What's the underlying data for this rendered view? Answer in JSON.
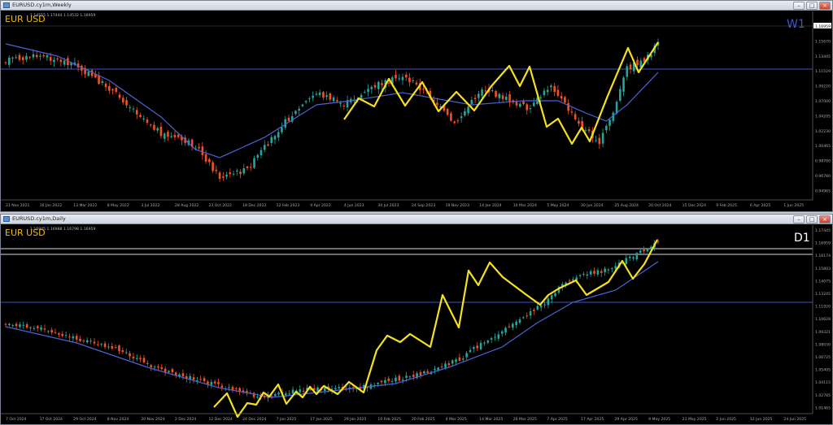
{
  "top_window": {
    "title": "EURUSD.cy1m,Weekly",
    "ohlc": "1.14555 1.17444 1.14532 1.16959",
    "symbol_label": "EUR USD",
    "timeframe_label": "W1",
    "price_labels": [
      "1.16959",
      "1.15670",
      "1.13445",
      "1.11529",
      "1.09220",
      "1.07000",
      "1.04205",
      "1.02230",
      "1.00465",
      "0.98780",
      "0.96780",
      "0.94965"
    ],
    "current_price": "1.16959",
    "hline_price": "1.11529",
    "date_labels": [
      "21 Nov 2021",
      "16 Jan 2022",
      "13 Mar 2022",
      "8 May 2022",
      "3 Jul 2022",
      "28 Aug 2022",
      "23 Oct 2022",
      "18 Dec 2022",
      "12 Feb 2023",
      "9 Apr 2023",
      "4 Jun 2023",
      "30 Jul 2023",
      "24 Sep 2023",
      "19 Nov 2023",
      "14 Jan 2024",
      "10 Mar 2024",
      "5 May 2024",
      "30 Jun 2024",
      "25 Aug 2024",
      "20 Oct 2024",
      "15 Dec 2024",
      "9 Feb 2025",
      "6 Apr 2025",
      "1 Jun 2025"
    ]
  },
  "bottom_window": {
    "title": "EURUSD.cy1m,Daily",
    "ohlc": "1.16945 1.16988 1.16798 1.16959",
    "symbol_label": "EUR USD",
    "timeframe_label": "D1",
    "price_labels": [
      "1.17445",
      "1.16959",
      "1.16174",
      "1.15803",
      "1.14075",
      "1.13245",
      "1.11920",
      "1.10628",
      "1.09321",
      "1.08030",
      "1.06725",
      "1.05405",
      "1.04115",
      "1.02785",
      "1.01465"
    ],
    "current_price": "1.16959",
    "level_prices": [
      "1.16174",
      "1.15803"
    ],
    "hline_price": "1.11529",
    "date_labels": [
      "7 Oct 2024",
      "17 Oct 2024",
      "29 Oct 2024",
      "8 Nov 2024",
      "20 Nov 2024",
      "2 Dec 2024",
      "12 Dec 2024",
      "24 Dec 2024",
      "7 Jan 2025",
      "17 Jan 2025",
      "29 Jan 2025",
      "10 Feb 2025",
      "20 Feb 2025",
      "4 Mar 2025",
      "14 Mar 2025",
      "26 Mar 2025",
      "7 Apr 2025",
      "17 Apr 2025",
      "29 Apr 2025",
      "9 May 2025",
      "21 May 2025",
      "2 Jun 2025",
      "12 Jun 2025",
      "24 Jun 2025"
    ]
  },
  "colors": {
    "background": "#000000",
    "bull_candle": "#26a69a",
    "bear_candle": "#ef5323",
    "zigzag": "#f5e11d",
    "moving_average": "#4a63d6",
    "hline": "#3b55c8",
    "symbol_label": "#f0b90b",
    "w1_label": "#3b5bd0",
    "d1_label": "#ffffff"
  }
}
